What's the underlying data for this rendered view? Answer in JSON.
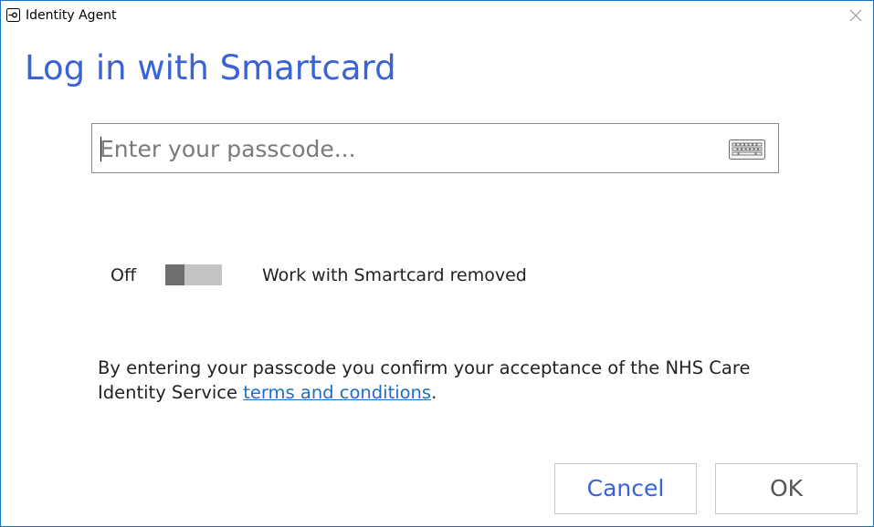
{
  "window": {
    "title": "Identity Agent",
    "accent_color": "#3b63d3",
    "border_color": "#1a73c9"
  },
  "icons": {
    "app": "smartcard-key-icon",
    "close": "close-icon",
    "keyboard": "keyboard-icon"
  },
  "main": {
    "heading": "Log in with Smartcard",
    "passcode": {
      "placeholder": "Enter your passcode...",
      "value": ""
    },
    "toggle": {
      "state_label": "Off",
      "is_on": false,
      "description": "Work with Smartcard removed"
    },
    "terms": {
      "prefix": "By entering your passcode you confirm your acceptance of the NHS Care Identity Service ",
      "link_text": "terms and conditions",
      "suffix": ".",
      "link_color": "#1a6fc4"
    }
  },
  "buttons": {
    "cancel": "Cancel",
    "ok": "OK"
  }
}
